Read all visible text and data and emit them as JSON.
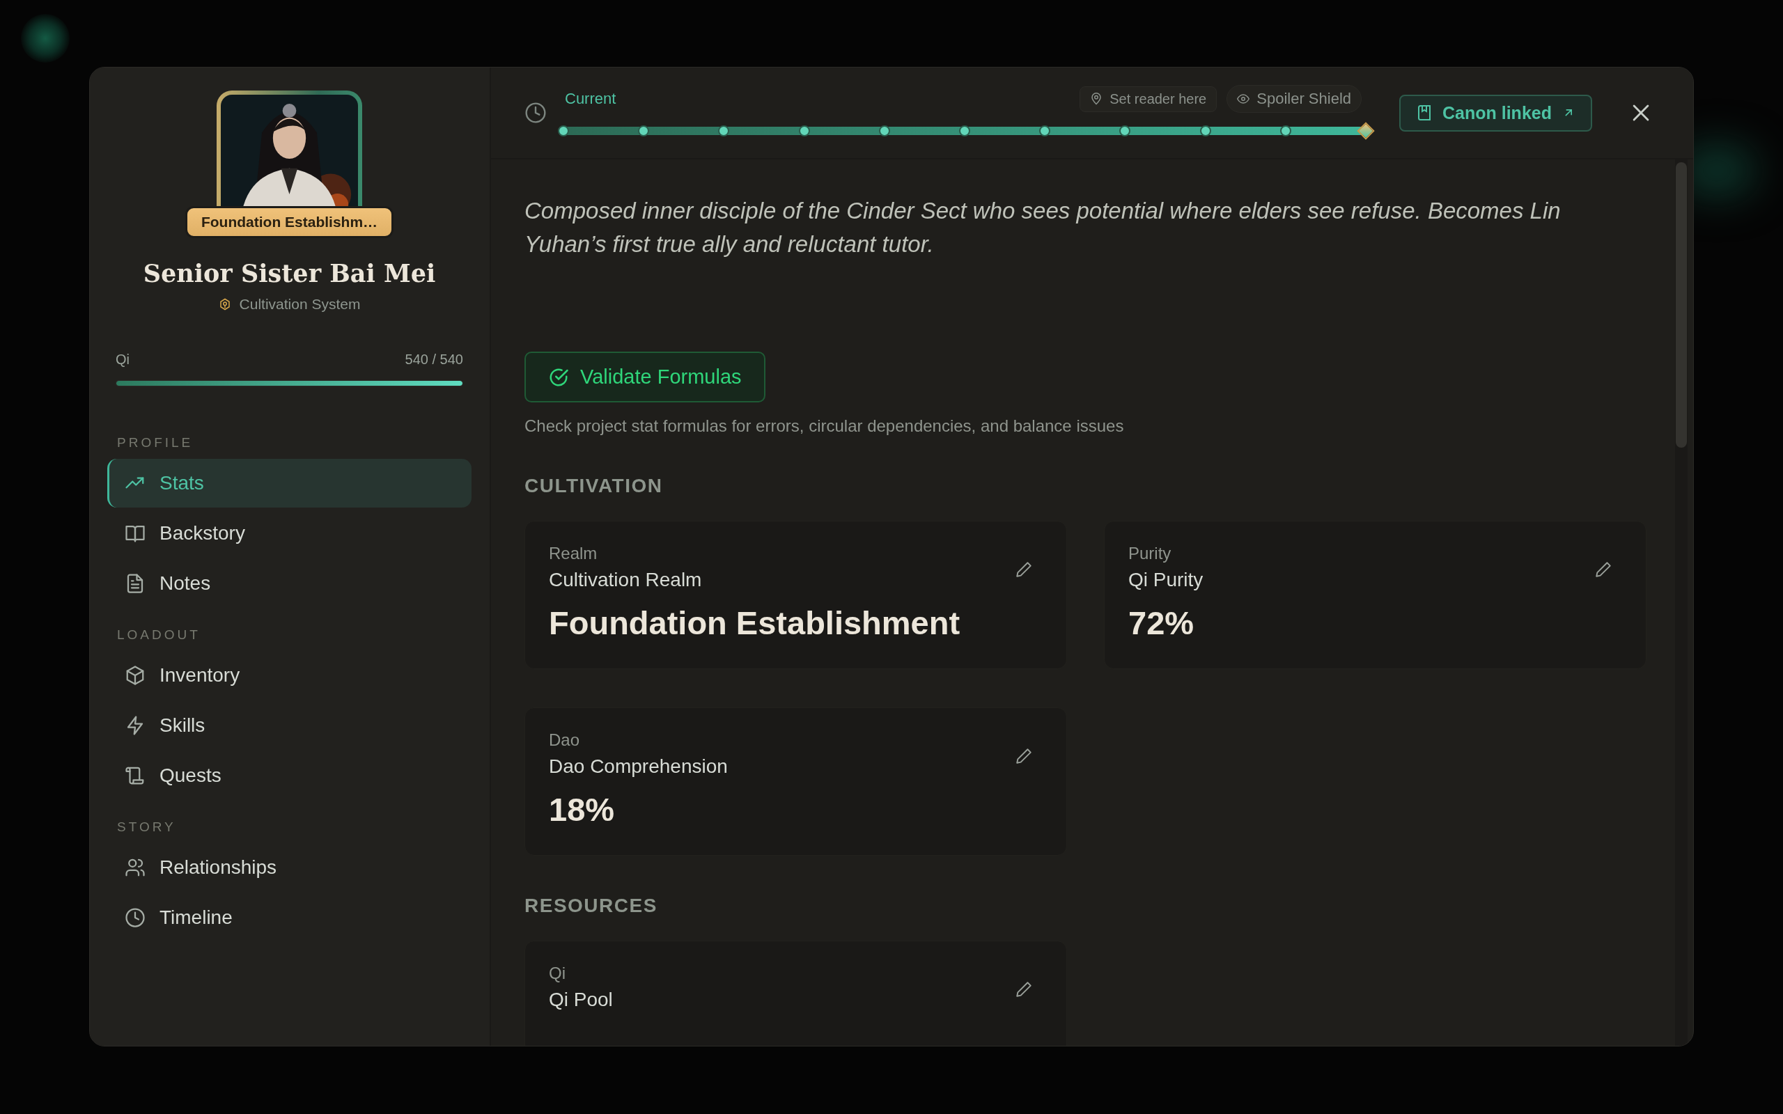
{
  "profile": {
    "badge": "Foundation Establishm…",
    "name": "Senior Sister Bai Mei",
    "system": "Cultivation System",
    "meter": {
      "label": "Qi",
      "reading": "540 / 540",
      "level": 1
    }
  },
  "nav": [
    {
      "heading": "PROFILE",
      "items": [
        {
          "label": "Stats",
          "selected": true
        },
        {
          "label": "Backstory",
          "selected": false
        },
        {
          "label": "Notes",
          "selected": false
        }
      ]
    },
    {
      "heading": "LOADOUT",
      "items": [
        {
          "label": "Inventory",
          "selected": false
        },
        {
          "label": "Skills",
          "selected": false
        },
        {
          "label": "Quests",
          "selected": false
        }
      ]
    },
    {
      "heading": "STORY",
      "items": [
        {
          "label": "Relationships",
          "selected": false
        },
        {
          "label": "Timeline",
          "selected": false
        }
      ]
    }
  ],
  "timeline": {
    "label": "Current",
    "level": 1,
    "points": [
      {
        "kind": "dot"
      },
      {
        "kind": "dot"
      },
      {
        "kind": "dot"
      },
      {
        "kind": "dot"
      },
      {
        "kind": "dot"
      },
      {
        "kind": "dot"
      },
      {
        "kind": "dot"
      },
      {
        "kind": "dot"
      },
      {
        "kind": "dot"
      },
      {
        "kind": "dot"
      },
      {
        "kind": "marker"
      }
    ]
  },
  "header_buttons": {
    "reader": "Set reader here",
    "spoiler": "Spoiler Shield",
    "canon": "Canon linked"
  },
  "description": "Composed inner disciple of the Cinder Sect who sees potential where elders see refuse. Becomes Lin Yuhan’s first true ally and reluctant tutor.",
  "validate": {
    "button": "Validate Formulas",
    "hint": "Check project stat formulas for errors, circular dependencies, and balance issues"
  },
  "sections": [
    {
      "heading": "CULTIVATION",
      "cards": [
        {
          "label": "Realm",
          "name": "Cultivation Realm",
          "value": "Foundation Establishment"
        },
        {
          "label": "Purity",
          "name": "Qi Purity",
          "value": "72%"
        },
        {
          "label": "Dao",
          "name": "Dao Comprehension",
          "value": "18%"
        }
      ]
    },
    {
      "heading": "RESOURCES",
      "cards": [
        {
          "label": "Qi",
          "name": "Qi Pool"
        }
      ]
    }
  ]
}
